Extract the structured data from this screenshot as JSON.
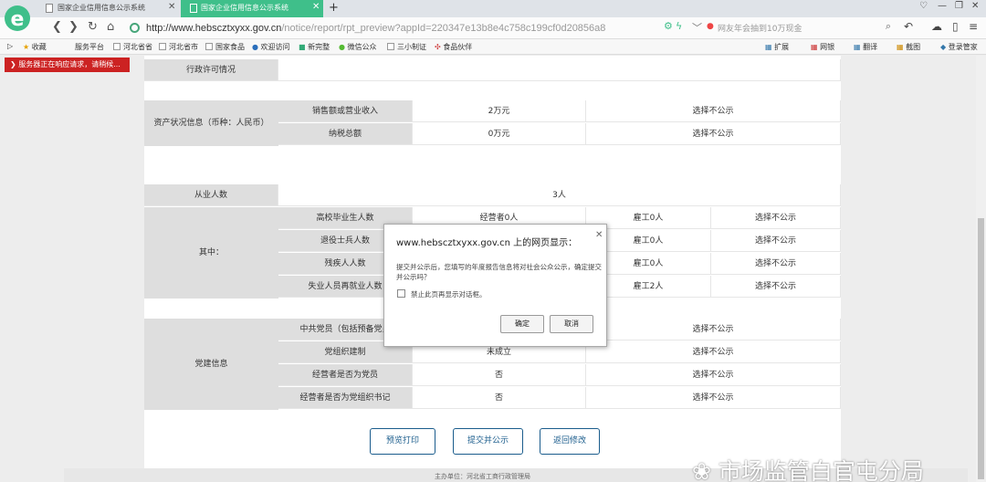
{
  "browser": {
    "tabs": [
      {
        "title": "国家企业信用信息公示系统",
        "active": false
      },
      {
        "title": "国家企业信用信息公示系统",
        "active": true
      }
    ],
    "url_host": "http://www.hebscztxyxx.gov.cn",
    "url_path": "/notice/report/rpt_preview?appId=220347e13b8e4c758c199cf0d20856a8",
    "search_placeholder": "网友年会抽到10万现金",
    "bookmarks": [
      "收藏",
      "服务平台",
      "河北省省",
      "河北省市",
      "国家食品",
      "欢迎访问",
      "新完整",
      "微信公众",
      "三小制证",
      "食品伙伴"
    ],
    "right_tools": [
      "扩展",
      "网银",
      "翻译",
      "截图",
      "登录管家"
    ],
    "accent_color": "#3fbf8a"
  },
  "notice": "服务器正在响应请求，请稍候...",
  "report": {
    "admin_license": "行政许可情况",
    "asset_section": "资产状况信息（币种：人民币）",
    "asset_rows": [
      {
        "label": "销售额或营业收入",
        "value": "2万元",
        "public": "选择不公示"
      },
      {
        "label": "纳税总额",
        "value": "0万元",
        "public": "选择不公示"
      }
    ],
    "employees_label": "从业人数",
    "employees_value": "3人",
    "among_label": "其中：",
    "among_rows": [
      {
        "label": "高校毕业生人数",
        "operator": "经营者0人",
        "hired": "雇工0人",
        "public": "选择不公示"
      },
      {
        "label": "退役士兵人数",
        "operator": "",
        "hired": "雇工0人",
        "public": "选择不公示"
      },
      {
        "label": "残疾人人数",
        "operator": "",
        "hired": "雇工0人",
        "public": "选择不公示"
      },
      {
        "label": "失业人员再就业人数",
        "operator": "",
        "hired": "雇工2人",
        "public": "选择不公示"
      }
    ],
    "party_section": "党建信息",
    "party_rows": [
      {
        "label": "中共党员（包括预备党员",
        "value": "",
        "public": "选择不公示"
      },
      {
        "label": "党组织建制",
        "value": "未成立",
        "public": "选择不公示"
      },
      {
        "label": "经营者是否为党员",
        "value": "否",
        "public": "选择不公示"
      },
      {
        "label": "经营者是否为党组织书记",
        "value": "否",
        "public": "选择不公示"
      }
    ],
    "buttons": {
      "print": "预览打印",
      "submit": "提交并公示",
      "back": "返回修改"
    },
    "footer": "主办单位：河北省工商行政管理局"
  },
  "dialog": {
    "title": "www.hebscztxyxx.gov.cn 上的网页显示：",
    "message": "提交并公示后，您填写的年度报告信息将对社会公众公示，确定提交并公示吗？",
    "checkbox_label": "禁止此页再显示对话框。",
    "ok": "确定",
    "cancel": "取消"
  },
  "watermark": "市场监管白官屯分局"
}
